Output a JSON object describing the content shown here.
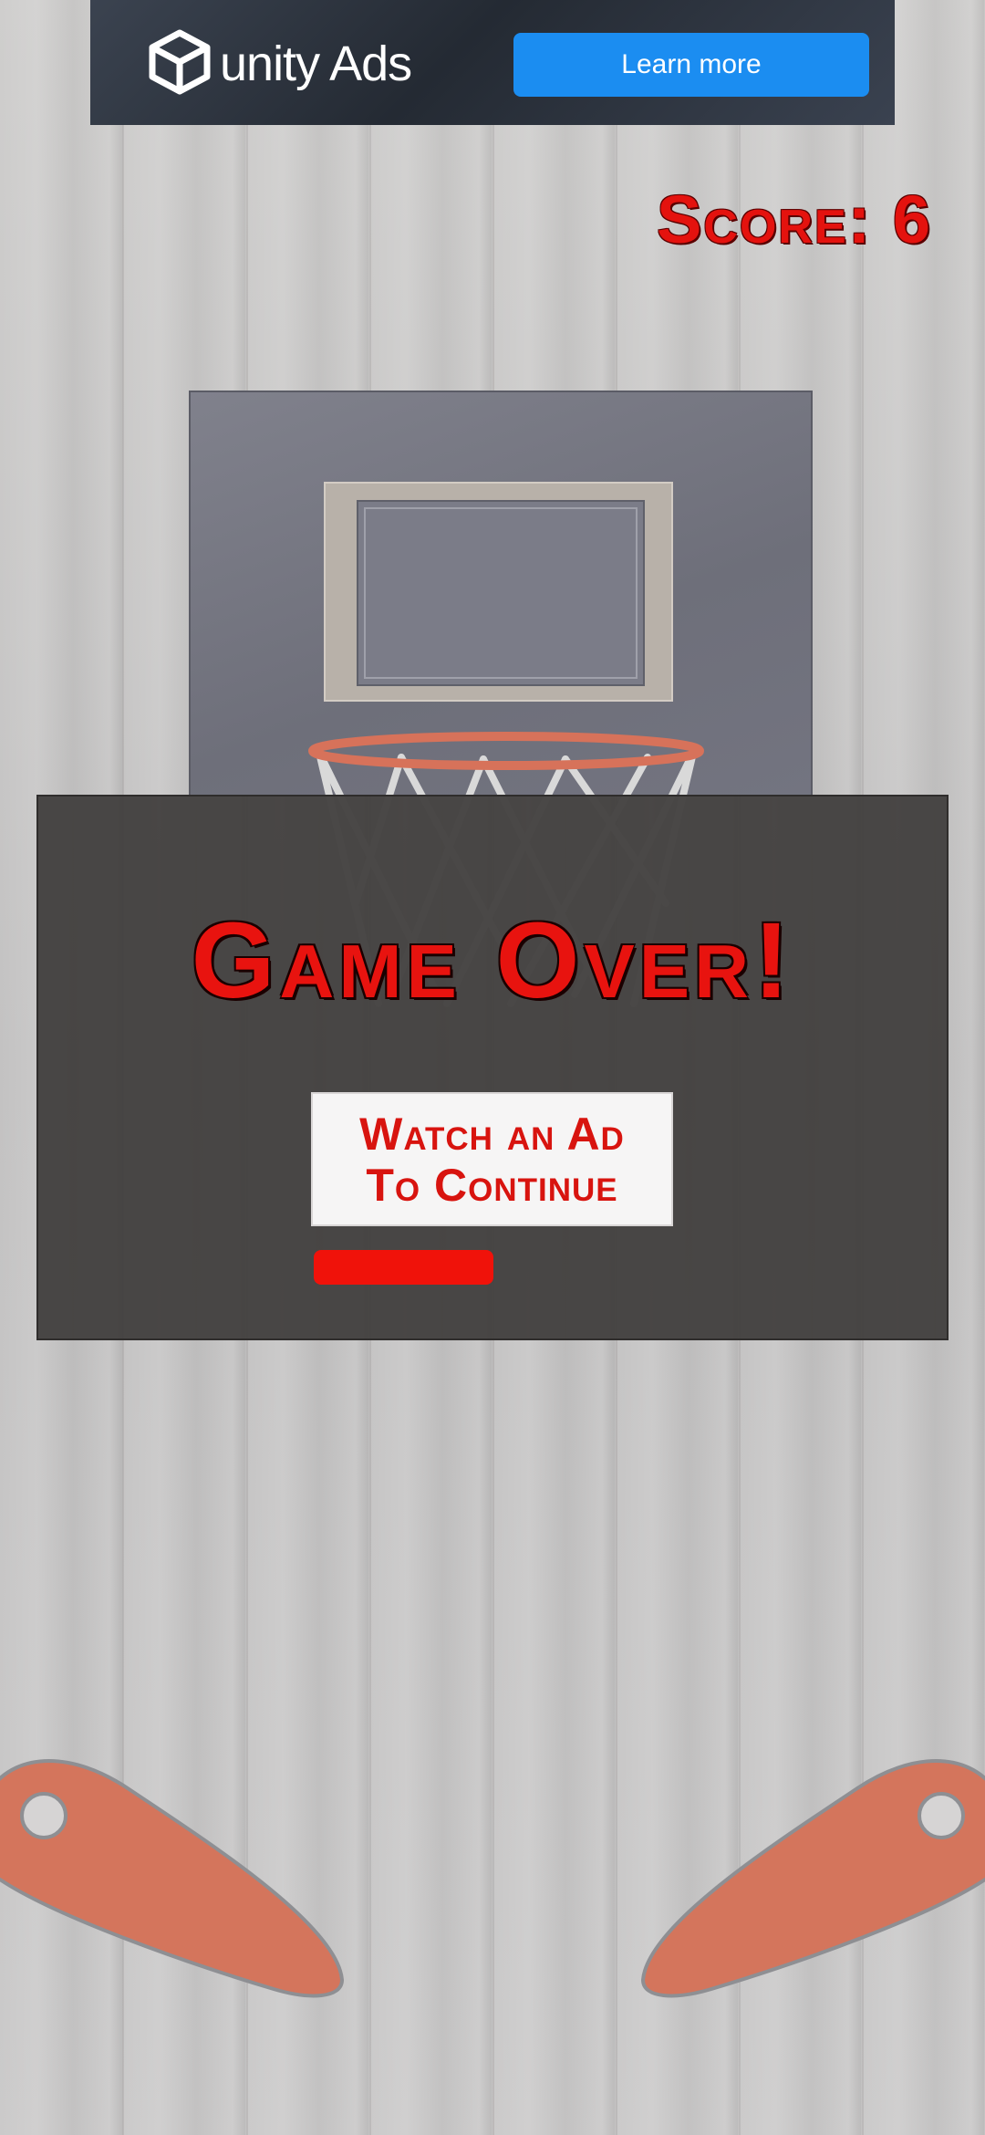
{
  "ad": {
    "brand": "unity Ads",
    "cta_label": "Learn more"
  },
  "score": {
    "text": "Score: 6"
  },
  "game_over": {
    "title": "Game Over!",
    "button_label": "Watch an Ad\nTo Continue",
    "timer_remaining_fraction": 0.5
  },
  "colors": {
    "accent_red": "#e4120e",
    "cta_blue": "#1b8df1",
    "flipper": "#d4755c"
  },
  "icons": {
    "ad_logo": "unity-logo-icon",
    "hoop": "basketball-hoop-icon",
    "flipper_left": "left-flipper-icon",
    "flipper_right": "right-flipper-icon"
  }
}
